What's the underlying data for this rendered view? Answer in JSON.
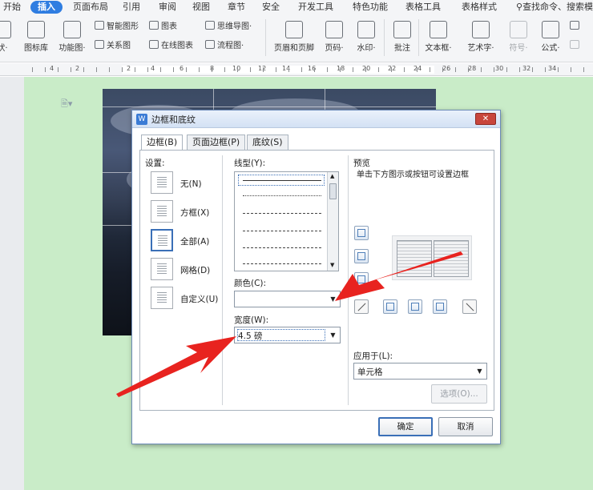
{
  "menubar": {
    "items": [
      "开始",
      "插入",
      "页面布局",
      "引用",
      "审阅",
      "视图",
      "章节",
      "安全",
      "开发工具",
      "特色功能",
      "表格工具",
      "表格样式"
    ],
    "active": "插入",
    "search": "查找命令、搜索模"
  },
  "ribbon": {
    "big_buttons": [
      "状·",
      "图标库",
      "功能图·",
      "页眉和页脚",
      "页码·",
      "水印·",
      "批注",
      "文本框·",
      "艺术字·",
      "符号·",
      "公式·"
    ],
    "small_buttons": [
      "智能图形",
      "图表",
      "思维导图·",
      "关系图",
      "在线图表",
      "流程图·",
      "",
      ""
    ]
  },
  "ruler": {
    "numbers": [
      "4",
      "2",
      "",
      "2",
      "4",
      "6",
      "8",
      "10",
      "12",
      "14",
      "16",
      "18",
      "20",
      "22",
      "24",
      "26",
      "28",
      "30",
      "32",
      "34"
    ]
  },
  "dialog": {
    "title": "边框和底纹",
    "close_label": "✕",
    "tabs": [
      "边框(B)",
      "页面边框(P)",
      "底纹(S)"
    ],
    "settings_label": "设置:",
    "settings": [
      "无(N)",
      "方框(X)",
      "全部(A)",
      "网格(D)",
      "自定义(U)"
    ],
    "settings_selected": "全部(A)",
    "linestyle_label": "线型(Y):",
    "color_label": "颜色(C):",
    "color_value": "",
    "width_label": "宽度(W):",
    "width_value": "4.5  磅",
    "preview_label": "预览",
    "preview_hint": "单击下方图示或按钮可设置边框",
    "apply_label": "应用于(L):",
    "apply_value": "单元格",
    "options_button": "选项(O)...",
    "ok_button": "确定",
    "cancel_button": "取消"
  },
  "colors": {
    "page_background": "#c9ecc8",
    "accent": "#2f7de1",
    "annotation_arrow": "#e8231f"
  }
}
